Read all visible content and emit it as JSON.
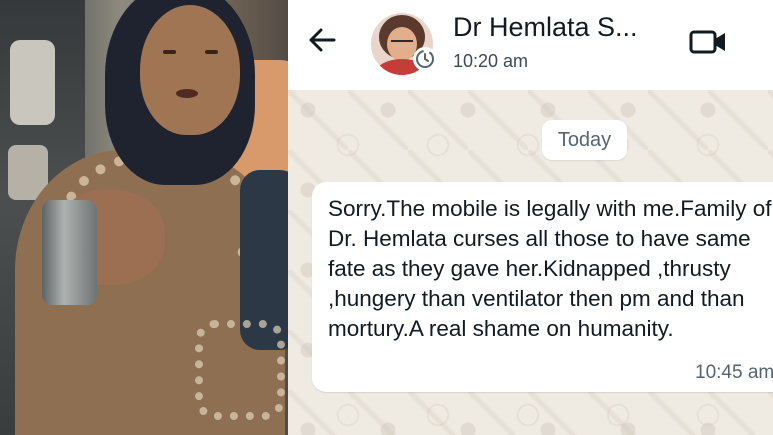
{
  "header": {
    "contact_name": "Dr Hemlata S...",
    "last_seen": "10:20 am"
  },
  "chat": {
    "date_chip": "Today",
    "message": {
      "text": "Sorry.The mobile is legally with me.Family of Dr. Hemlata curses all those to have same fate as they gave her.Kidnapped ,thrusty ,hungery than ventilator then pm and than mortury.A real shame on humanity.",
      "time": "10:45 am"
    }
  },
  "icons": {
    "back": "back-arrow-icon",
    "video": "video-call-icon",
    "timer": "disappearing-timer-icon"
  },
  "colors": {
    "chat_background": "#efeae2",
    "bubble": "#ffffff",
    "text": "#111b21",
    "secondary_text": "#54656f"
  }
}
